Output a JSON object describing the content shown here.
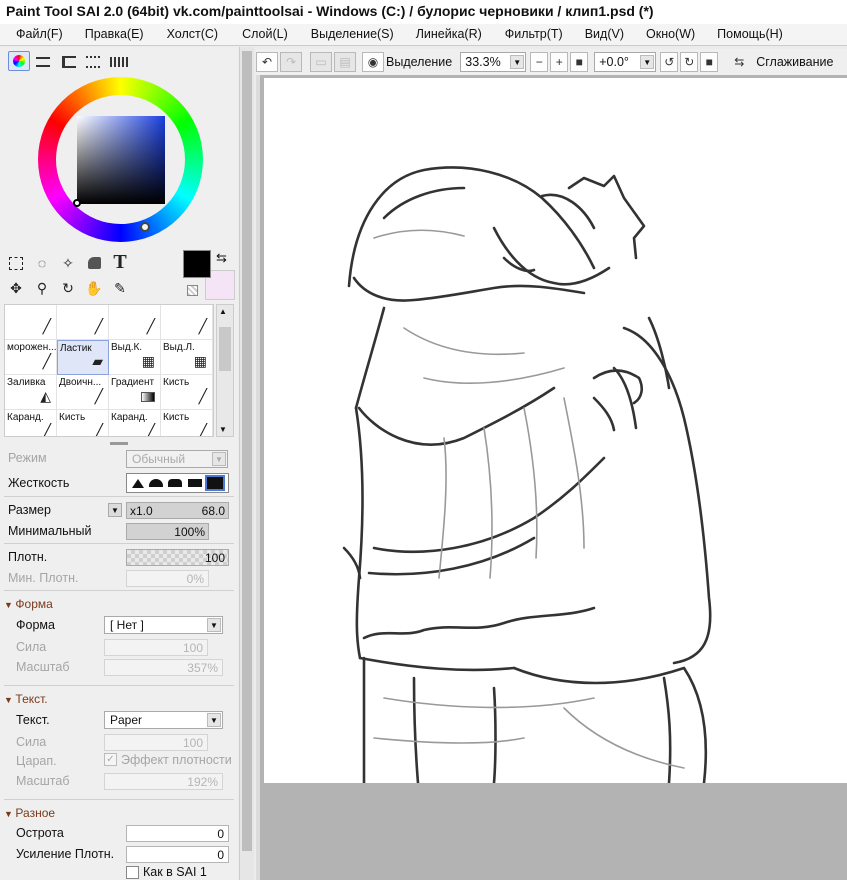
{
  "window": {
    "title": "Paint Tool SAI 2.0 (64bit) vk.com/painttoolsai - Windows (C:) / булорис черновики / клип1.psd (*)"
  },
  "menu": [
    "Файл(F)",
    "Правка(E)",
    "Холст(C)",
    "Слой(L)",
    "Выделение(S)",
    "Линейка(R)",
    "Фильтр(T)",
    "Вид(V)",
    "Окно(W)",
    "Помощь(H)"
  ],
  "canvas_toolbar": {
    "selection_label": "Выделение",
    "zoom": "33.3%",
    "rotation": "+0.0°",
    "smoothing_label": "Сглаживание"
  },
  "colors": {
    "primary": "#000000",
    "secondary": "#f4e4f6"
  },
  "brushes": [
    {
      "name": ""
    },
    {
      "name": ""
    },
    {
      "name": ""
    },
    {
      "name": ""
    },
    {
      "name": "морожен..."
    },
    {
      "name": "Ластик"
    },
    {
      "name": "Выд.К."
    },
    {
      "name": "Выд.Л."
    },
    {
      "name": "Заливка"
    },
    {
      "name": "Двоичн..."
    },
    {
      "name": "Градиент"
    },
    {
      "name": "Кисть"
    },
    {
      "name": "Каранд."
    },
    {
      "name": "Кисть"
    },
    {
      "name": "Каранд."
    },
    {
      "name": "Кисть"
    }
  ],
  "props": {
    "mode_label": "Режим",
    "mode_value": "Обычный",
    "hardness_label": "Жесткость",
    "size_label": "Размер",
    "size_mult": "x1.0",
    "size_value": "68.0",
    "min_label": "Минимальный",
    "min_value": "100%",
    "density_label": "Плотн.",
    "density_value": "100",
    "min_density_label": "Мин. Плотн.",
    "min_density_value": "0%"
  },
  "shape_section": {
    "title": "Форма",
    "shape_label": "Форма",
    "shape_value": "[ Нет ]",
    "strength_label": "Сила",
    "strength_value": "100",
    "scale_label": "Масштаб",
    "scale_value": "357%"
  },
  "texture_section": {
    "title": "Текст.",
    "texture_label": "Текст.",
    "texture_value": "Paper",
    "strength_label": "Сила",
    "strength_value": "100",
    "scratch_label": "Царап.",
    "density_effect_label": "Эффект плотности",
    "scale_label": "Масштаб",
    "scale_value": "192%"
  },
  "misc_section": {
    "title": "Разное",
    "sharpness_label": "Острота",
    "sharpness_value": "0",
    "density_boost_label": "Усиление Плотн.",
    "density_boost_value": "0",
    "like_sai1_label": "Как в SAI 1"
  }
}
